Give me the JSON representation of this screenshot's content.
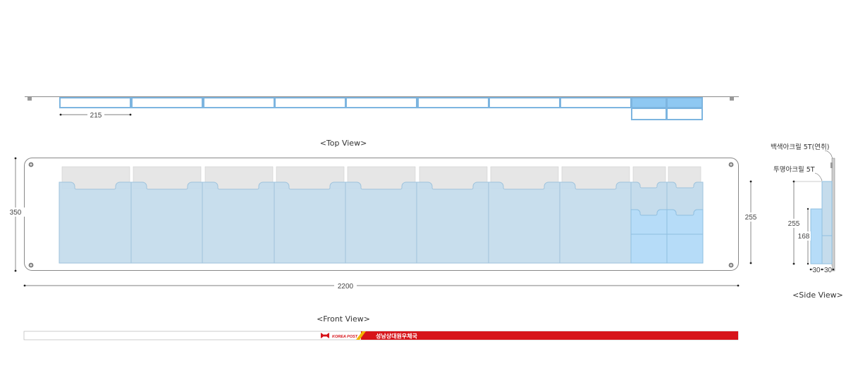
{
  "views": {
    "top": "<Top View>",
    "front": "<Front View>",
    "side": "<Side View>"
  },
  "dimensions": {
    "pocket_width": "215",
    "total_width": "2200",
    "total_height": "350",
    "pocket_height": "255",
    "side_height": "255",
    "side_inner": "168",
    "side_depth_1": "30",
    "side_depth_2": "30"
  },
  "materials": {
    "white_acrylic": "백색아크릴 5T(연취)",
    "clear_acrylic": "투명아크릴 5T"
  },
  "banner": {
    "logo_text": "KOREA POST",
    "office_name": "성남상대원우체국"
  },
  "colors": {
    "pocket_fill": "#c5dcec",
    "pocket_stroke": "#9fc3dc",
    "highlight_fill": "#b6dcf8",
    "top_view_stroke": "#7db5e0",
    "banner_red": "#d7141a",
    "header_gray": "#e6e6e6"
  }
}
